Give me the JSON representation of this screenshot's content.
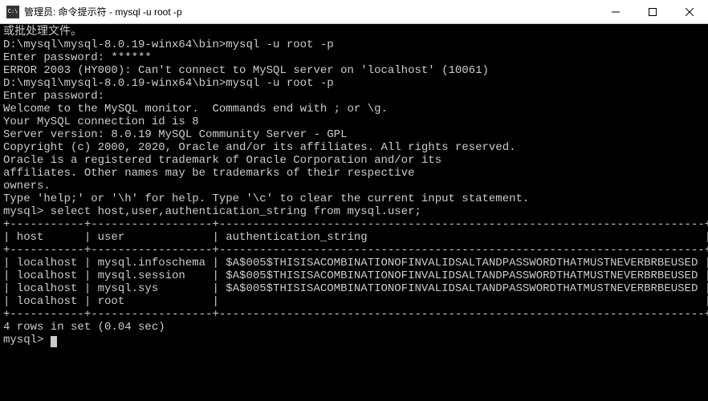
{
  "window": {
    "title": "管理员: 命令提示符 - mysql  -u root -p"
  },
  "terminal": {
    "lines": [
      "或批处理文件。",
      "",
      "D:\\mysql\\mysql-8.0.19-winx64\\bin>mysql -u root -p",
      "Enter password: ******",
      "ERROR 2003 (HY000): Can't connect to MySQL server on 'localhost' (10061)",
      "",
      "D:\\mysql\\mysql-8.0.19-winx64\\bin>mysql -u root -p",
      "Enter password:",
      "Welcome to the MySQL monitor.  Commands end with ; or \\g.",
      "Your MySQL connection id is 8",
      "Server version: 8.0.19 MySQL Community Server - GPL",
      "",
      "Copyright (c) 2000, 2020, Oracle and/or its affiliates. All rights reserved.",
      "",
      "Oracle is a registered trademark of Oracle Corporation and/or its",
      "affiliates. Other names may be trademarks of their respective",
      "owners.",
      "",
      "Type 'help;' or '\\h' for help. Type '\\c' to clear the current input statement.",
      "",
      "mysql> select host,user,authentication_string from mysql.user;"
    ],
    "table": {
      "border_top": "+-----------+------------------+------------------------------------------------------------------------+",
      "header_row": "| host      | user             | authentication_string                                                  |",
      "border_mid": "+-----------+------------------+------------------------------------------------------------------------+",
      "rows": [
        {
          "host": "localhost",
          "user": "mysql.infoschema",
          "auth": "$A$005$THISISACOMBINATIONOFINVALIDSALTANDPASSWORDTHATMUSTNEVERBRBEUSED"
        },
        {
          "host": "localhost",
          "user": "mysql.session",
          "auth": "$A$005$THISISACOMBINATIONOFINVALIDSALTANDPASSWORDTHATMUSTNEVERBRBEUSED"
        },
        {
          "host": "localhost",
          "user": "mysql.sys",
          "auth": "$A$005$THISISACOMBINATIONOFINVALIDSALTANDPASSWORDTHATMUSTNEVERBRBEUSED"
        },
        {
          "host": "localhost",
          "user": "root",
          "auth": ""
        }
      ],
      "border_bot": "+-----------+------------------+------------------------------------------------------------------------+"
    },
    "footer": [
      "4 rows in set (0.04 sec)",
      "",
      "mysql> "
    ]
  }
}
